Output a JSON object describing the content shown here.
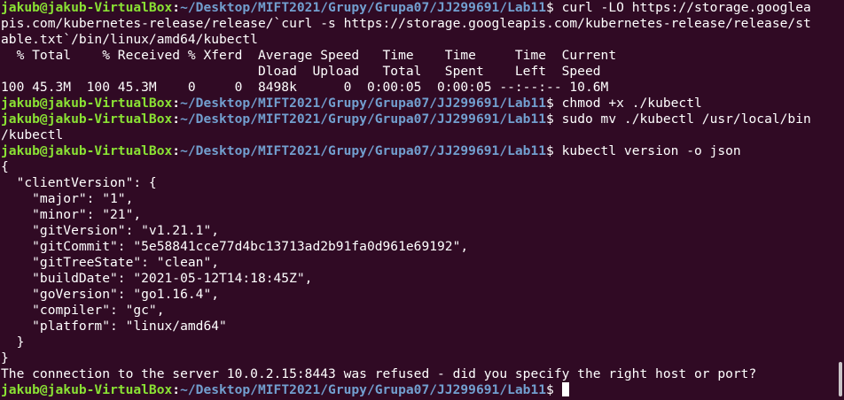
{
  "prompt": {
    "user_host": "jakub@jakub-VirtualBox",
    "separator": ":",
    "path": "~/Desktop/MIFT2021/Grupy/Grupa07/JJ299691/Lab11",
    "dollar": "$"
  },
  "output": {
    "curl_cmd_1": " curl -LO https://storage.googlea",
    "curl_cmd_2": "pis.com/kubernetes-release/release/`curl -s https://storage.googleapis.com/kubernetes-release/release/st",
    "curl_cmd_3": "able.txt`/bin/linux/amd64/kubectl",
    "curl_header_1": "  % Total    % Received % Xferd  Average Speed   Time    Time     Time  Current",
    "curl_header_2": "                                 Dload  Upload   Total   Spent    Left  Speed",
    "curl_progress": "100 45.3M  100 45.3M    0     0  8498k      0  0:00:05  0:00:05 --:--:-- 10.6M",
    "chmod_cmd": " chmod +x ./kubectl",
    "mv_cmd_1": " sudo mv ./kubectl /usr/local/bin",
    "mv_cmd_2": "/kubectl",
    "version_cmd": " kubectl version -o json",
    "json_lines": [
      "{",
      "  \"clientVersion\": {",
      "    \"major\": \"1\",",
      "    \"minor\": \"21\",",
      "    \"gitVersion\": \"v1.21.1\",",
      "    \"gitCommit\": \"5e58841cce77d4bc13713ad2b91fa0d961e69192\",",
      "    \"gitTreeState\": \"clean\",",
      "    \"buildDate\": \"2021-05-12T14:18:45Z\",",
      "    \"goVersion\": \"go1.16.4\",",
      "    \"compiler\": \"gc\",",
      "    \"platform\": \"linux/amd64\"",
      "  }",
      "}"
    ],
    "error_line": "The connection to the server 10.0.2.15:8443 was refused - did you specify the right host or port?",
    "last_cmd": " "
  },
  "colors": {
    "background": "#300a24",
    "prompt_user": "#8ae234",
    "prompt_path": "#729fcf",
    "text": "#ffffff"
  }
}
